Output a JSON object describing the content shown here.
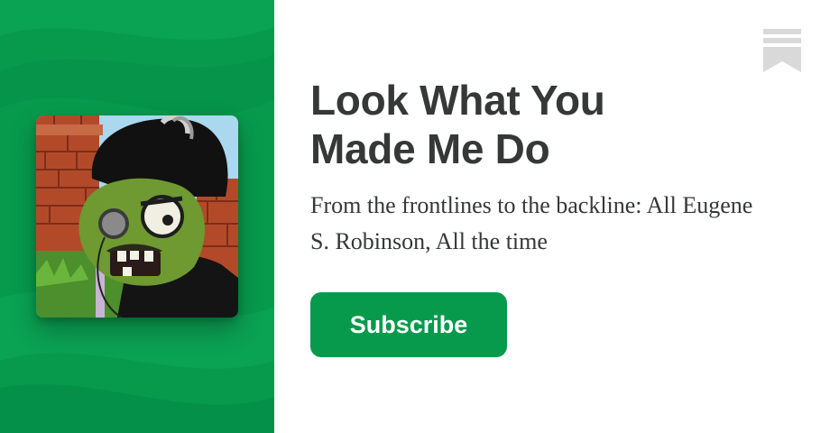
{
  "publication": {
    "title": "Look What You Made Me Do",
    "description": "From the frontlines to the backline: All Eugene S. Robinson, All the time",
    "subscribe_label": "Subscribe",
    "logo_icon": "zombie-avatar-icon",
    "bookmark_icon": "bookmark-icon"
  },
  "colors": {
    "brand_green": "#079a4c",
    "text_dark": "#363737",
    "background": "#ffffff",
    "bookmark_gray": "#d9d9d9"
  }
}
